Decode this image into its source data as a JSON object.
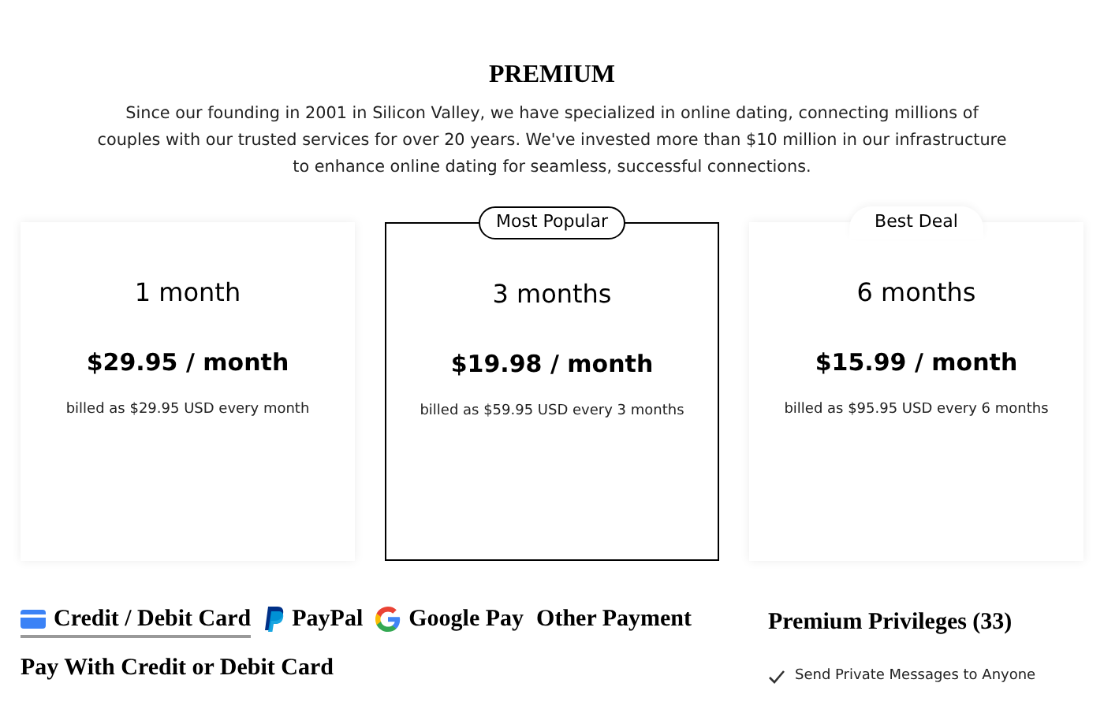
{
  "title": "PREMIUM",
  "intro": "Since our founding in 2001 in Silicon Valley, we have specialized in online dating, connecting millions of couples with our trusted services for over 20 years. We've invested more than $10 million in our infrastructure to enhance online dating for seamless, successful connections.",
  "plans": [
    {
      "duration": "1 month",
      "price": "$29.95 / month",
      "billing": "billed as $29.95 USD every month",
      "selected": false
    },
    {
      "duration": "3 months",
      "price": "$19.98 / month",
      "billing": "billed as $59.95 USD every 3 months",
      "selected": true,
      "badge": {
        "kind": "outlined",
        "label": "Most Popular"
      }
    },
    {
      "duration": "6 months",
      "price": "$15.99 / month",
      "billing": "billed as $95.95 USD every 6 months",
      "selected": false,
      "badge": {
        "kind": "soft",
        "label": "Best Deal"
      }
    }
  ],
  "payment_tabs": [
    {
      "kind": "card",
      "label": "Credit / Debit Card",
      "selected": true
    },
    {
      "kind": "paypal",
      "label": "PayPal",
      "selected": false
    },
    {
      "kind": "google",
      "label": "Google Pay",
      "selected": false
    },
    {
      "kind": "other",
      "label": "Other Payment",
      "selected": false
    }
  ],
  "payment_heading": "Pay With Credit or Debit Card",
  "privileges": {
    "title": "Premium Privileges (33)",
    "items": [
      "Send Private Messages to Anyone"
    ]
  }
}
